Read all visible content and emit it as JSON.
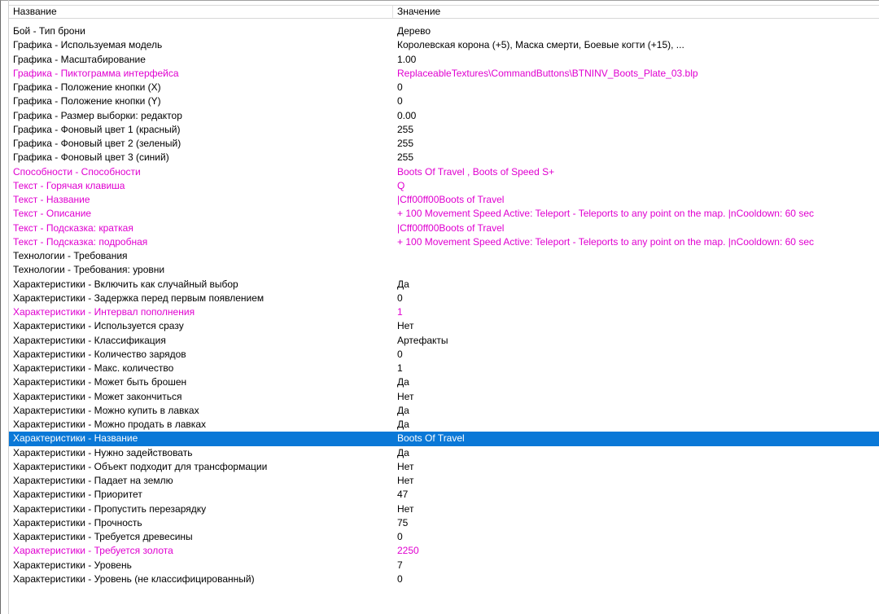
{
  "columns": {
    "name": "Название",
    "value": "Значение"
  },
  "rows": [
    {
      "name": "Бой - Тип брони",
      "value": "Дерево",
      "modified": false
    },
    {
      "name": "Графика - Используемая модель",
      "value": "Королевская корона (+5), Маска смерти, Боевые когти (+15), ...",
      "modified": false
    },
    {
      "name": "Графика - Масштабирование",
      "value": "1.00",
      "modified": false
    },
    {
      "name": "Графика - Пиктограмма интерфейса",
      "value": "ReplaceableTextures\\CommandButtons\\BTNINV_Boots_Plate_03.blp",
      "modified": true
    },
    {
      "name": "Графика - Положение кнопки (X)",
      "value": "0",
      "modified": false
    },
    {
      "name": "Графика - Положение кнопки (Y)",
      "value": "0",
      "modified": false
    },
    {
      "name": "Графика - Размер выборки: редактор",
      "value": "0.00",
      "modified": false
    },
    {
      "name": "Графика - Фоновый цвет 1 (красный)",
      "value": "255",
      "modified": false
    },
    {
      "name": "Графика - Фоновый цвет 2 (зеленый)",
      "value": "255",
      "modified": false
    },
    {
      "name": "Графика - Фоновый цвет 3 (синий)",
      "value": "255",
      "modified": false
    },
    {
      "name": "Способности - Способности",
      "value": "Boots Of Travel , Boots of Speed S+",
      "modified": true
    },
    {
      "name": "Текст - Горячая клавиша",
      "value": "Q",
      "modified": true
    },
    {
      "name": "Текст - Название",
      "value": "|Cff00ff00Boots of Travel",
      "modified": true
    },
    {
      "name": "Текст - Описание",
      "value": "+ 100 Movement Speed Active: Teleport - Teleports to any point on the map. |nCooldown: 60 sec",
      "modified": true
    },
    {
      "name": "Текст - Подсказка: краткая",
      "value": "|Cff00ff00Boots of Travel",
      "modified": true
    },
    {
      "name": "Текст - Подсказка: подробная",
      "value": "+ 100 Movement Speed Active: Teleport - Teleports to any point on the map. |nCooldown: 60 sec",
      "modified": true
    },
    {
      "name": "Технологии - Требования",
      "value": "",
      "modified": false
    },
    {
      "name": "Технологии - Требования: уровни",
      "value": "",
      "modified": false
    },
    {
      "name": "Характеристики - Включить как случайный выбор",
      "value": "Да",
      "modified": false
    },
    {
      "name": "Характеристики - Задержка перед первым появлением",
      "value": "0",
      "modified": false
    },
    {
      "name": "Характеристики - Интервал пополнения",
      "value": "1",
      "modified": true
    },
    {
      "name": "Характеристики - Используется сразу",
      "value": "Нет",
      "modified": false
    },
    {
      "name": "Характеристики - Классификация",
      "value": "Артефакты",
      "modified": false
    },
    {
      "name": "Характеристики - Количество зарядов",
      "value": "0",
      "modified": false
    },
    {
      "name": "Характеристики - Макс. количество",
      "value": "1",
      "modified": false
    },
    {
      "name": "Характеристики - Может быть брошен",
      "value": "Да",
      "modified": false
    },
    {
      "name": "Характеристики - Может закончиться",
      "value": "Нет",
      "modified": false
    },
    {
      "name": "Характеристики - Можно купить в лавках",
      "value": "Да",
      "modified": false
    },
    {
      "name": "Характеристики - Можно продать в лавках",
      "value": "Да",
      "modified": false
    },
    {
      "name": "Характеристики - Название",
      "value": "Boots Of Travel",
      "modified": false,
      "selected": true
    },
    {
      "name": "Характеристики - Нужно задействовать",
      "value": "Да",
      "modified": false
    },
    {
      "name": "Характеристики - Объект подходит для трансформации",
      "value": "Нет",
      "modified": false
    },
    {
      "name": "Характеристики - Падает на землю",
      "value": "Нет",
      "modified": false
    },
    {
      "name": "Характеристики - Приоритет",
      "value": "47",
      "modified": false
    },
    {
      "name": "Характеристики - Пропустить перезарядку",
      "value": "Нет",
      "modified": false
    },
    {
      "name": "Характеристики - Прочность",
      "value": "75",
      "modified": false
    },
    {
      "name": "Характеристики - Требуется древесины",
      "value": "0",
      "modified": false
    },
    {
      "name": "Характеристики - Требуется золота",
      "value": "2250",
      "modified": true
    },
    {
      "name": "Характеристики - Уровень",
      "value": "7",
      "modified": false
    },
    {
      "name": "Характеристики - Уровень (не классифицированный)",
      "value": "0",
      "modified": false
    }
  ],
  "colors": {
    "modified_text": "#e000d0",
    "selection_bg": "#0a78d7",
    "selection_text": "#ffffff"
  }
}
